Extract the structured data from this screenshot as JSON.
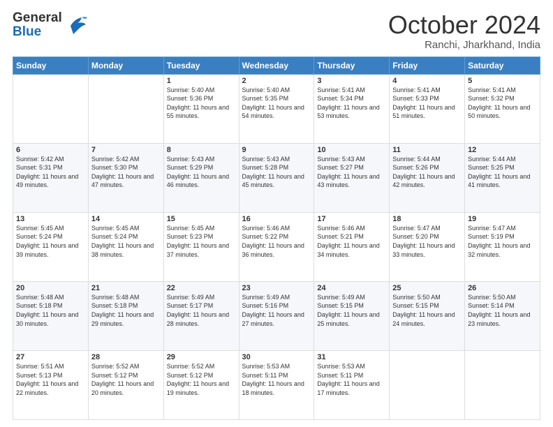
{
  "header": {
    "logo_line1": "General",
    "logo_line2": "Blue",
    "month": "October 2024",
    "location": "Ranchi, Jharkhand, India"
  },
  "days_of_week": [
    "Sunday",
    "Monday",
    "Tuesday",
    "Wednesday",
    "Thursday",
    "Friday",
    "Saturday"
  ],
  "weeks": [
    [
      {
        "day": "",
        "sunrise": "",
        "sunset": "",
        "daylight": ""
      },
      {
        "day": "",
        "sunrise": "",
        "sunset": "",
        "daylight": ""
      },
      {
        "day": "1",
        "sunrise": "Sunrise: 5:40 AM",
        "sunset": "Sunset: 5:36 PM",
        "daylight": "Daylight: 11 hours and 55 minutes."
      },
      {
        "day": "2",
        "sunrise": "Sunrise: 5:40 AM",
        "sunset": "Sunset: 5:35 PM",
        "daylight": "Daylight: 11 hours and 54 minutes."
      },
      {
        "day": "3",
        "sunrise": "Sunrise: 5:41 AM",
        "sunset": "Sunset: 5:34 PM",
        "daylight": "Daylight: 11 hours and 53 minutes."
      },
      {
        "day": "4",
        "sunrise": "Sunrise: 5:41 AM",
        "sunset": "Sunset: 5:33 PM",
        "daylight": "Daylight: 11 hours and 51 minutes."
      },
      {
        "day": "5",
        "sunrise": "Sunrise: 5:41 AM",
        "sunset": "Sunset: 5:32 PM",
        "daylight": "Daylight: 11 hours and 50 minutes."
      }
    ],
    [
      {
        "day": "6",
        "sunrise": "Sunrise: 5:42 AM",
        "sunset": "Sunset: 5:31 PM",
        "daylight": "Daylight: 11 hours and 49 minutes."
      },
      {
        "day": "7",
        "sunrise": "Sunrise: 5:42 AM",
        "sunset": "Sunset: 5:30 PM",
        "daylight": "Daylight: 11 hours and 47 minutes."
      },
      {
        "day": "8",
        "sunrise": "Sunrise: 5:43 AM",
        "sunset": "Sunset: 5:29 PM",
        "daylight": "Daylight: 11 hours and 46 minutes."
      },
      {
        "day": "9",
        "sunrise": "Sunrise: 5:43 AM",
        "sunset": "Sunset: 5:28 PM",
        "daylight": "Daylight: 11 hours and 45 minutes."
      },
      {
        "day": "10",
        "sunrise": "Sunrise: 5:43 AM",
        "sunset": "Sunset: 5:27 PM",
        "daylight": "Daylight: 11 hours and 43 minutes."
      },
      {
        "day": "11",
        "sunrise": "Sunrise: 5:44 AM",
        "sunset": "Sunset: 5:26 PM",
        "daylight": "Daylight: 11 hours and 42 minutes."
      },
      {
        "day": "12",
        "sunrise": "Sunrise: 5:44 AM",
        "sunset": "Sunset: 5:25 PM",
        "daylight": "Daylight: 11 hours and 41 minutes."
      }
    ],
    [
      {
        "day": "13",
        "sunrise": "Sunrise: 5:45 AM",
        "sunset": "Sunset: 5:24 PM",
        "daylight": "Daylight: 11 hours and 39 minutes."
      },
      {
        "day": "14",
        "sunrise": "Sunrise: 5:45 AM",
        "sunset": "Sunset: 5:24 PM",
        "daylight": "Daylight: 11 hours and 38 minutes."
      },
      {
        "day": "15",
        "sunrise": "Sunrise: 5:45 AM",
        "sunset": "Sunset: 5:23 PM",
        "daylight": "Daylight: 11 hours and 37 minutes."
      },
      {
        "day": "16",
        "sunrise": "Sunrise: 5:46 AM",
        "sunset": "Sunset: 5:22 PM",
        "daylight": "Daylight: 11 hours and 36 minutes."
      },
      {
        "day": "17",
        "sunrise": "Sunrise: 5:46 AM",
        "sunset": "Sunset: 5:21 PM",
        "daylight": "Daylight: 11 hours and 34 minutes."
      },
      {
        "day": "18",
        "sunrise": "Sunrise: 5:47 AM",
        "sunset": "Sunset: 5:20 PM",
        "daylight": "Daylight: 11 hours and 33 minutes."
      },
      {
        "day": "19",
        "sunrise": "Sunrise: 5:47 AM",
        "sunset": "Sunset: 5:19 PM",
        "daylight": "Daylight: 11 hours and 32 minutes."
      }
    ],
    [
      {
        "day": "20",
        "sunrise": "Sunrise: 5:48 AM",
        "sunset": "Sunset: 5:18 PM",
        "daylight": "Daylight: 11 hours and 30 minutes."
      },
      {
        "day": "21",
        "sunrise": "Sunrise: 5:48 AM",
        "sunset": "Sunset: 5:18 PM",
        "daylight": "Daylight: 11 hours and 29 minutes."
      },
      {
        "day": "22",
        "sunrise": "Sunrise: 5:49 AM",
        "sunset": "Sunset: 5:17 PM",
        "daylight": "Daylight: 11 hours and 28 minutes."
      },
      {
        "day": "23",
        "sunrise": "Sunrise: 5:49 AM",
        "sunset": "Sunset: 5:16 PM",
        "daylight": "Daylight: 11 hours and 27 minutes."
      },
      {
        "day": "24",
        "sunrise": "Sunrise: 5:49 AM",
        "sunset": "Sunset: 5:15 PM",
        "daylight": "Daylight: 11 hours and 25 minutes."
      },
      {
        "day": "25",
        "sunrise": "Sunrise: 5:50 AM",
        "sunset": "Sunset: 5:15 PM",
        "daylight": "Daylight: 11 hours and 24 minutes."
      },
      {
        "day": "26",
        "sunrise": "Sunrise: 5:50 AM",
        "sunset": "Sunset: 5:14 PM",
        "daylight": "Daylight: 11 hours and 23 minutes."
      }
    ],
    [
      {
        "day": "27",
        "sunrise": "Sunrise: 5:51 AM",
        "sunset": "Sunset: 5:13 PM",
        "daylight": "Daylight: 11 hours and 22 minutes."
      },
      {
        "day": "28",
        "sunrise": "Sunrise: 5:52 AM",
        "sunset": "Sunset: 5:12 PM",
        "daylight": "Daylight: 11 hours and 20 minutes."
      },
      {
        "day": "29",
        "sunrise": "Sunrise: 5:52 AM",
        "sunset": "Sunset: 5:12 PM",
        "daylight": "Daylight: 11 hours and 19 minutes."
      },
      {
        "day": "30",
        "sunrise": "Sunrise: 5:53 AM",
        "sunset": "Sunset: 5:11 PM",
        "daylight": "Daylight: 11 hours and 18 minutes."
      },
      {
        "day": "31",
        "sunrise": "Sunrise: 5:53 AM",
        "sunset": "Sunset: 5:11 PM",
        "daylight": "Daylight: 11 hours and 17 minutes."
      },
      {
        "day": "",
        "sunrise": "",
        "sunset": "",
        "daylight": ""
      },
      {
        "day": "",
        "sunrise": "",
        "sunset": "",
        "daylight": ""
      }
    ]
  ]
}
